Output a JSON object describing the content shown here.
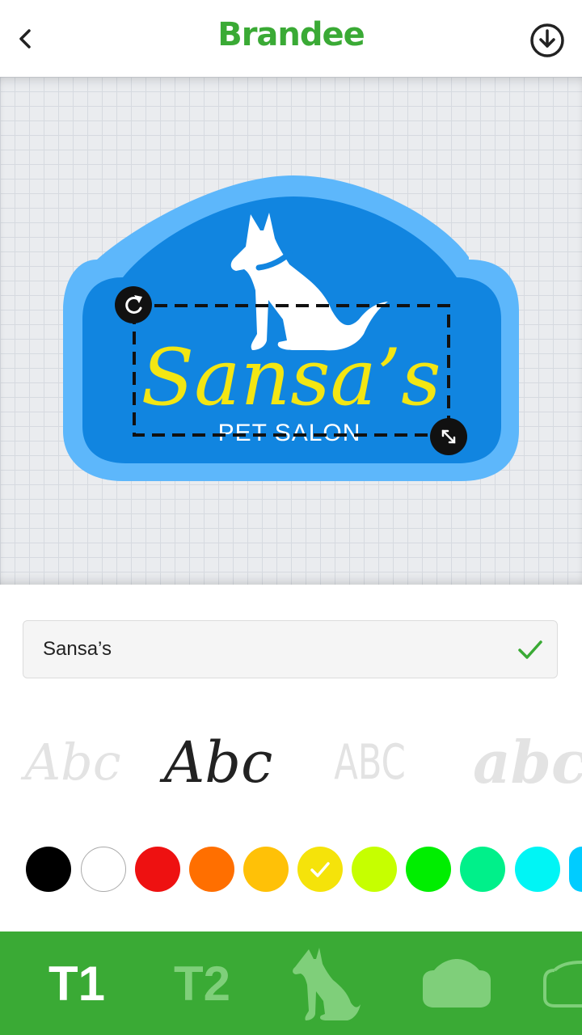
{
  "header": {
    "brand": "Brandee"
  },
  "logo": {
    "main_text": "Sansa’s",
    "sub_text": "PET SALON"
  },
  "editor": {
    "text_value": "Sansa’s"
  },
  "fonts": [
    {
      "label": "Abc",
      "selected": false
    },
    {
      "label": "Abc",
      "selected": true
    },
    {
      "label": "ABC",
      "selected": false
    },
    {
      "label": "abc",
      "selected": false
    }
  ],
  "colors": [
    "#000000",
    "#ffffff",
    "#ee1111",
    "#ff6f00",
    "#ffc107",
    "#f5e30a",
    "#c6ff00",
    "#00ee00",
    "#00f08a",
    "#00f5f5",
    "#00ccff"
  ],
  "selected_color": "#f5e30a",
  "tabs": [
    {
      "label": "T1",
      "active": true
    },
    {
      "label": "T2",
      "active": false
    }
  ]
}
